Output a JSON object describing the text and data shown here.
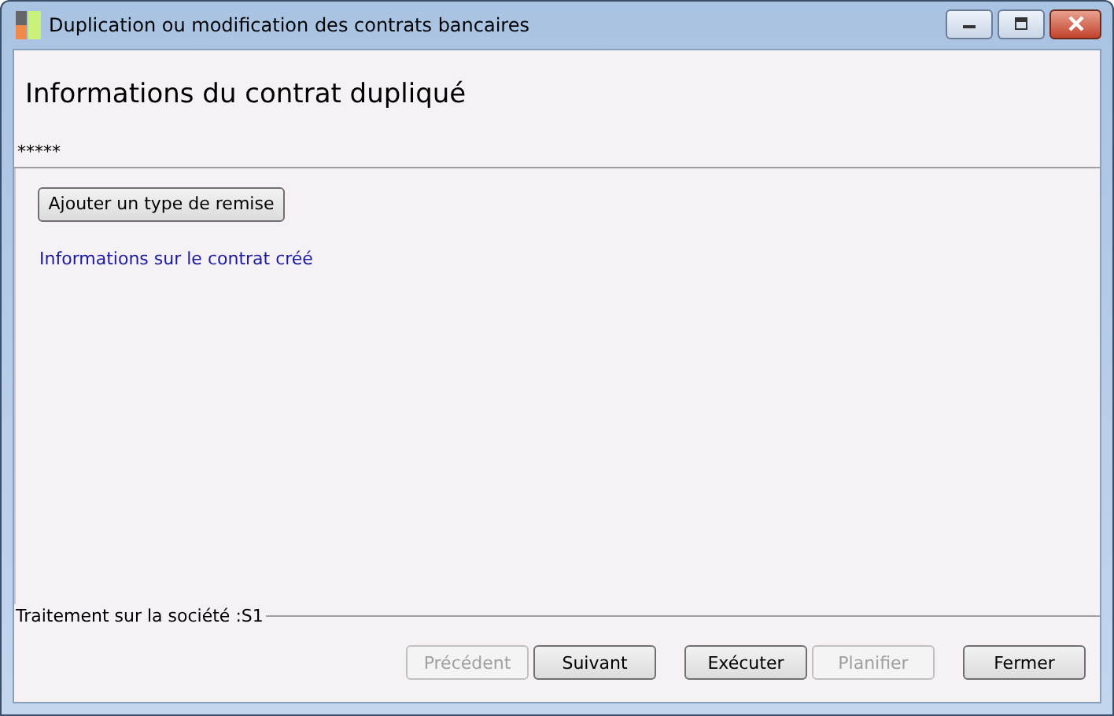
{
  "window": {
    "title": "Duplication ou modification des contrats bancaires"
  },
  "heading": "Informations du contrat dupliqué",
  "subtitle": "*****",
  "add_button": {
    "label": "Ajouter un type de remise",
    "disabled": false
  },
  "link": "Informations sur le contrat créé",
  "status": "Traitement sur la société :S1",
  "button_groups": [
    [
      {
        "label": "Précédent",
        "disabled": true
      },
      {
        "label": "Suivant",
        "disabled": false
      }
    ],
    [
      {
        "label": "Exécuter",
        "disabled": false
      },
      {
        "label": "Planifier",
        "disabled": true
      }
    ],
    [
      {
        "label": "Fermer",
        "disabled": false
      }
    ]
  ]
}
